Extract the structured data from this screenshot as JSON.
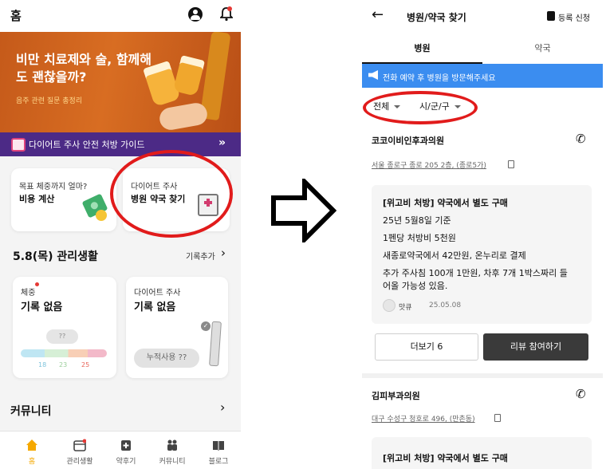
{
  "left": {
    "header": {
      "title": "홈"
    },
    "banner": {
      "title": "비만 치료제와 술, 함께해도 괜찮을까?",
      "subtitle": "음주 관련 질문 총정리",
      "active_slide": 3,
      "slide_count": 8
    },
    "guide_bar": {
      "text": "다이어트 주사 안전 처방 가이드",
      "arrow": "»"
    },
    "cards": [
      {
        "sub": "목표 체중까지 얼마?",
        "main": "비용 계산"
      },
      {
        "sub": "다이어트 주사",
        "main": "병원 약국 찾기"
      }
    ],
    "daily": {
      "title": "5.8(목) 관리생활",
      "add_label": "기록추가",
      "weight": {
        "label": "체중",
        "value": "기록 없음",
        "pill": "??",
        "ticks": [
          "18",
          "23",
          "25"
        ]
      },
      "injection": {
        "label": "다이어트 주사",
        "value": "기록 없음",
        "pill": "누적사용 ??"
      }
    },
    "community": {
      "title": "커뮤니티"
    },
    "tabbar": [
      {
        "label": "홈",
        "icon": "home-icon"
      },
      {
        "label": "관리생활",
        "icon": "calendar-icon"
      },
      {
        "label": "약후기",
        "icon": "pill-box-icon"
      },
      {
        "label": "커뮤니티",
        "icon": "people-icon"
      },
      {
        "label": "블로그",
        "icon": "book-icon"
      }
    ]
  },
  "right": {
    "header": {
      "back": "←",
      "title": "병원/약국 찾기",
      "register": "등록 신청"
    },
    "tabs": [
      {
        "label": "병원",
        "active": true
      },
      {
        "label": "약국",
        "active": false
      }
    ],
    "notice": "전화 예약 후 병원을 방문해주세요",
    "filters": {
      "all": "전체",
      "city": "시/군/구"
    },
    "clinics": [
      {
        "name": "코코이비인후과의원",
        "address": "서울 종로구 종로 205 2층, (종로5가)",
        "review": {
          "lines": [
            "[위고비 처방] 약국에서 별도 구매",
            "25년 5월8일 기준",
            "1펜당 처방비 5천원",
            "새종로약국에서 42만원, 온누리로 결제",
            "추가 주사침 100개 1만원, 차후 7개 1박스짜리 들",
            "어올 가능성 있음."
          ],
          "user": "맛큐",
          "date": "25.05.08"
        },
        "more_label": "더보기 6",
        "review_btn": "리뷰 참여하기"
      },
      {
        "name": "김피부과의원",
        "address": "대구 수성구 청호로 496, (만촌동)",
        "review": {
          "lines": [
            "[위고비 처방] 약국에서 별도 구매"
          ]
        }
      }
    ]
  },
  "colors": {
    "accent": "#f5a800",
    "highlight": "#e11b1b",
    "notice": "#3b8df0",
    "banner": "#c55a1a",
    "guide": "#4c2a86"
  }
}
